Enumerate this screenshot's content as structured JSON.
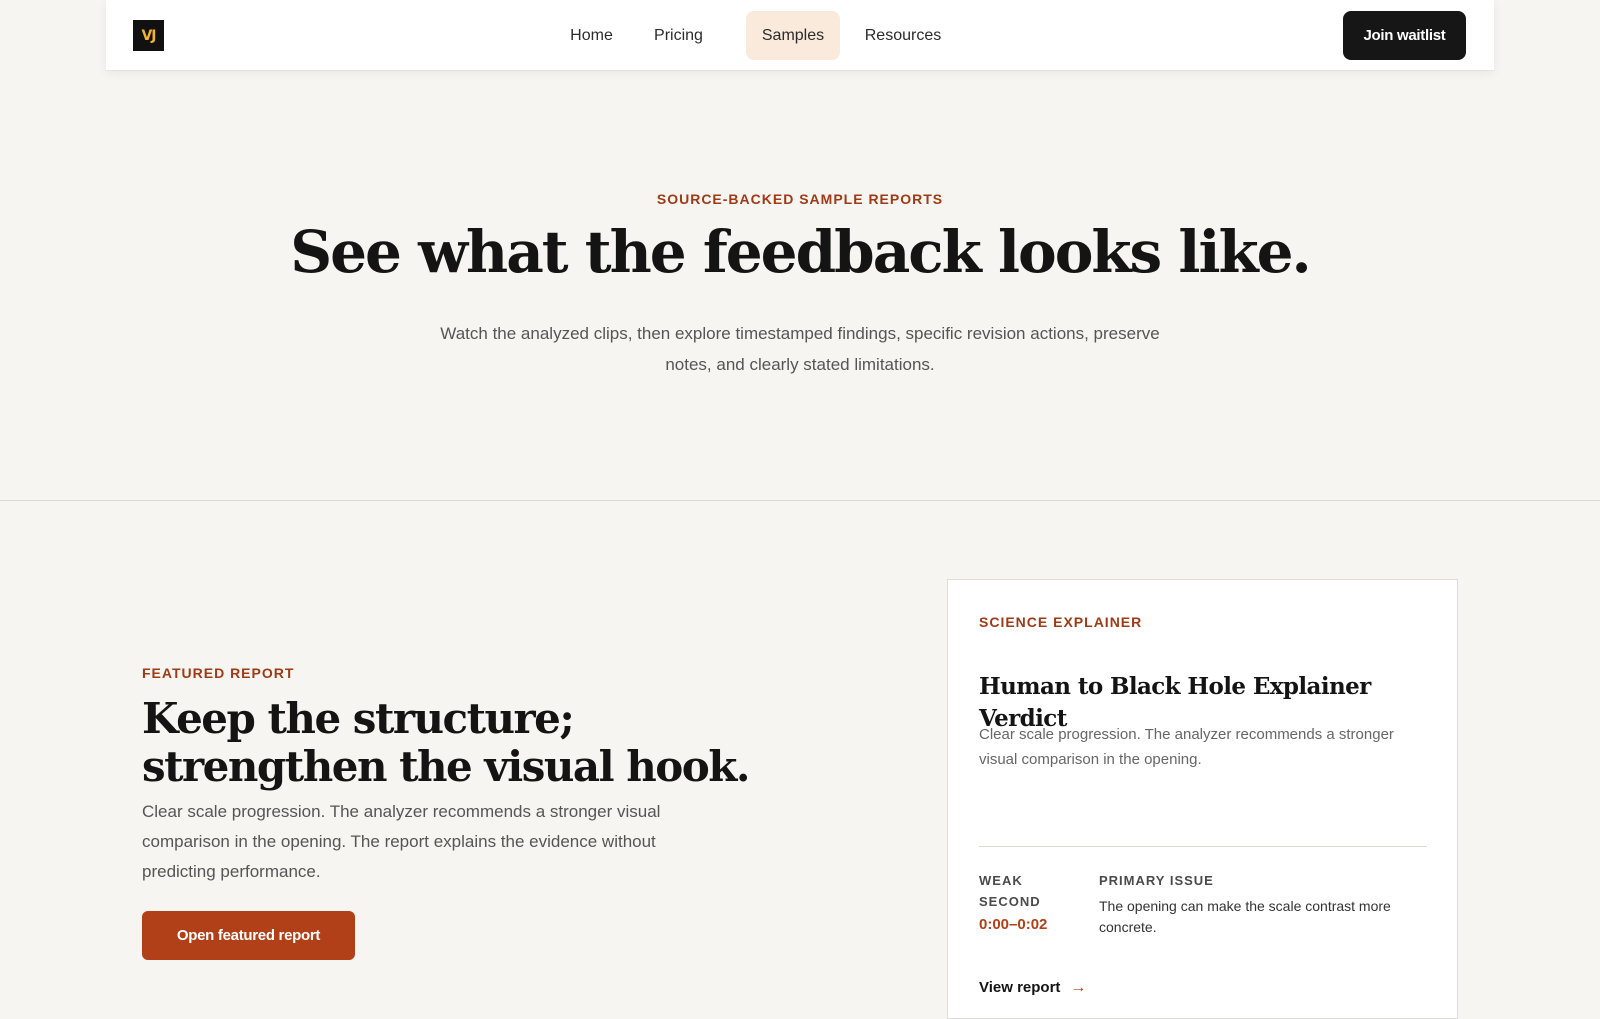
{
  "logo": {
    "text": "VJ"
  },
  "nav": {
    "items": [
      {
        "label": "Home"
      },
      {
        "label": "Pricing"
      },
      {
        "label": "Samples",
        "active": true
      },
      {
        "label": "Resources"
      }
    ],
    "join_label": "Join waitlist"
  },
  "hero": {
    "eyebrow": "SOURCE-BACKED SAMPLE REPORTS",
    "title": "See what the feedback looks like.",
    "subtitle": "Watch the analyzed clips, then explore timestamped findings, specific revision actions, preserve notes, and clearly stated limitations."
  },
  "featured": {
    "eyebrow": "FEATURED REPORT",
    "title": "Keep the structure; strengthen the visual hook.",
    "description": "Clear scale progression. The analyzer recommends a stronger visual comparison in the opening. The report explains the evidence without predicting performance.",
    "button_label": "Open featured report"
  },
  "card": {
    "eyebrow": "SCIENCE EXPLAINER",
    "title": "Human to Black Hole Explainer Verdict",
    "description": "Clear scale progression. The analyzer recommends a stronger visual comparison in the opening.",
    "weak_label": "WEAK SECOND",
    "weak_time": "0:00–0:02",
    "issue_label": "PRIMARY ISSUE",
    "issue_text": "The opening can make the scale contrast more concrete.",
    "view_label": "View report",
    "arrow": "→"
  },
  "colors": {
    "accent": "#b13f17",
    "eyebrow": "#9e3a16",
    "background": "#f7f5f1",
    "active_nav": "#faeadb",
    "dark": "#161616"
  }
}
